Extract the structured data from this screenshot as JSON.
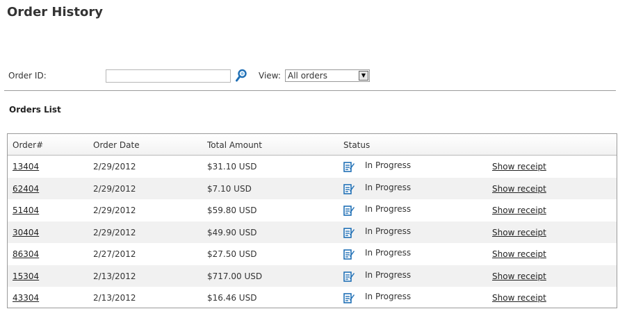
{
  "page": {
    "title": "Order History"
  },
  "filters": {
    "order_id_label": "Order ID:",
    "order_id_value": "",
    "view_label": "View:",
    "view_selected": "All orders"
  },
  "orders_list": {
    "title": "Orders List",
    "columns": [
      "Order#",
      "Order Date",
      "Total Amount",
      "Status"
    ],
    "rows": [
      {
        "order": "13404",
        "date": "2/29/2012",
        "total": "$31.10 USD",
        "status": "In Progress",
        "receipt": "Show receipt"
      },
      {
        "order": "62404",
        "date": "2/29/2012",
        "total": "$7.10 USD",
        "status": "In Progress",
        "receipt": "Show receipt"
      },
      {
        "order": "51404",
        "date": "2/29/2012",
        "total": "$59.80 USD",
        "status": "In Progress",
        "receipt": "Show receipt"
      },
      {
        "order": "30404",
        "date": "2/29/2012",
        "total": "$49.90 USD",
        "status": "In Progress",
        "receipt": "Show receipt"
      },
      {
        "order": "86304",
        "date": "2/27/2012",
        "total": "$27.50 USD",
        "status": "In Progress",
        "receipt": "Show receipt"
      },
      {
        "order": "15304",
        "date": "2/13/2012",
        "total": "$717.00 USD",
        "status": "In Progress",
        "receipt": "Show receipt"
      },
      {
        "order": "43304",
        "date": "2/13/2012",
        "total": "$16.46 USD",
        "status": "In Progress",
        "receipt": "Show receipt"
      }
    ]
  },
  "icons": {
    "search": "search-icon",
    "status": "in-progress-icon",
    "dropdown": "chevron-down-icon"
  },
  "colors": {
    "icon_blue": "#1f6fb5",
    "alt_row": "#f1f1f1",
    "border": "#9a9a9a"
  }
}
